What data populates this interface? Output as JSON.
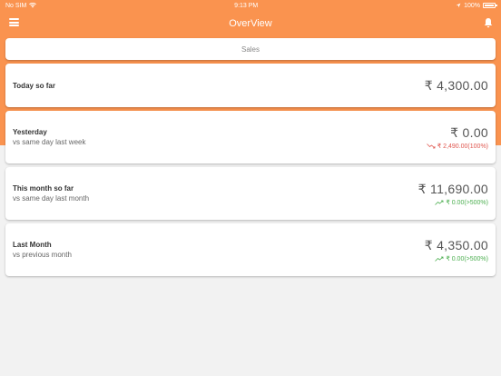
{
  "status_bar": {
    "carrier": "No SIM",
    "time": "9:13 PM",
    "battery": "100%"
  },
  "nav": {
    "title": "OverView"
  },
  "tab": {
    "label": "Sales"
  },
  "rows": [
    {
      "title": "Today so far",
      "subtitle": "",
      "amount": "₹ 4,300.00",
      "change": "",
      "trend": ""
    },
    {
      "title": "Yesterday",
      "subtitle": "vs same day last week",
      "amount": "₹ 0.00",
      "change": "₹ 2,490.00(100%)",
      "trend": "down"
    },
    {
      "title": "This month so far",
      "subtitle": "vs same day last month",
      "amount": "₹ 11,690.00",
      "change": "₹ 0.00(>500%)",
      "trend": "up"
    },
    {
      "title": "Last Month",
      "subtitle": "vs previous month",
      "amount": "₹ 4,350.00",
      "change": "₹ 0.00(>500%)",
      "trend": "up"
    }
  ],
  "colors": {
    "header": "#fa934f",
    "background": "#f2f2f2",
    "down": "#e0574f",
    "up": "#4caf50"
  },
  "icons": {
    "menu": "hamburger-menu-icon",
    "bell": "bell-icon",
    "wifi": "wifi-icon",
    "location": "location-arrow-icon",
    "battery": "battery-icon",
    "trend_down": "trend-down-icon",
    "trend_up": "trend-up-icon"
  }
}
